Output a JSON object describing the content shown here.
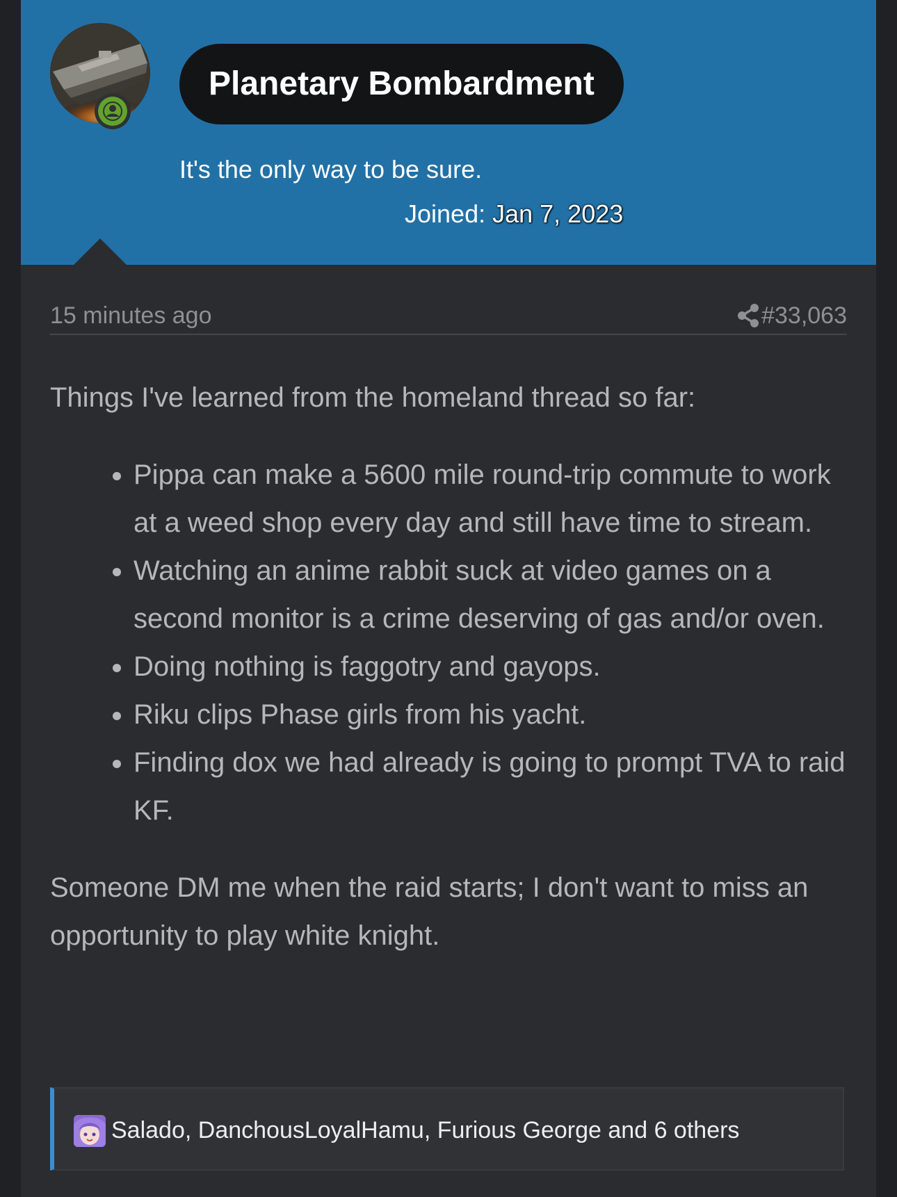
{
  "user": {
    "name": "Planetary Bombardment",
    "title": "It's the only way to be sure.",
    "joined_label": "Joined:",
    "joined_date": "Jan 7, 2023",
    "avatar": "star-destroyer-avatar",
    "status_icon": "online-user-icon"
  },
  "post": {
    "time": "15 minutes ago",
    "share_icon": "share-icon",
    "number": "#33,063",
    "intro": "Things I've learned from the homeland thread so far:",
    "bullets": [
      "Pippa can make a 5600 mile round-trip commute to work at a weed shop every day and still have time to stream.",
      "Watching an anime rabbit suck at video games on a second monitor is a crime deserving of gas and/or oven.",
      "Doing nothing is faggotry and gayops.",
      "Riku clips Phase girls from his yacht.",
      "Finding dox we had already is going to prompt TVA to raid KF."
    ],
    "outro": "Someone DM me when the raid starts; I don't want to miss an opportunity to play white knight."
  },
  "reactions": {
    "text": "Salado, DanchousLoyalHamu, Furious George and 6 others",
    "avatar": "anime-girl-avatar"
  },
  "colors": {
    "header_bg": "#2271a6",
    "post_bg": "#2a2c30",
    "online_green": "#62a32c",
    "reaction_accent": "#3b8fd0"
  }
}
